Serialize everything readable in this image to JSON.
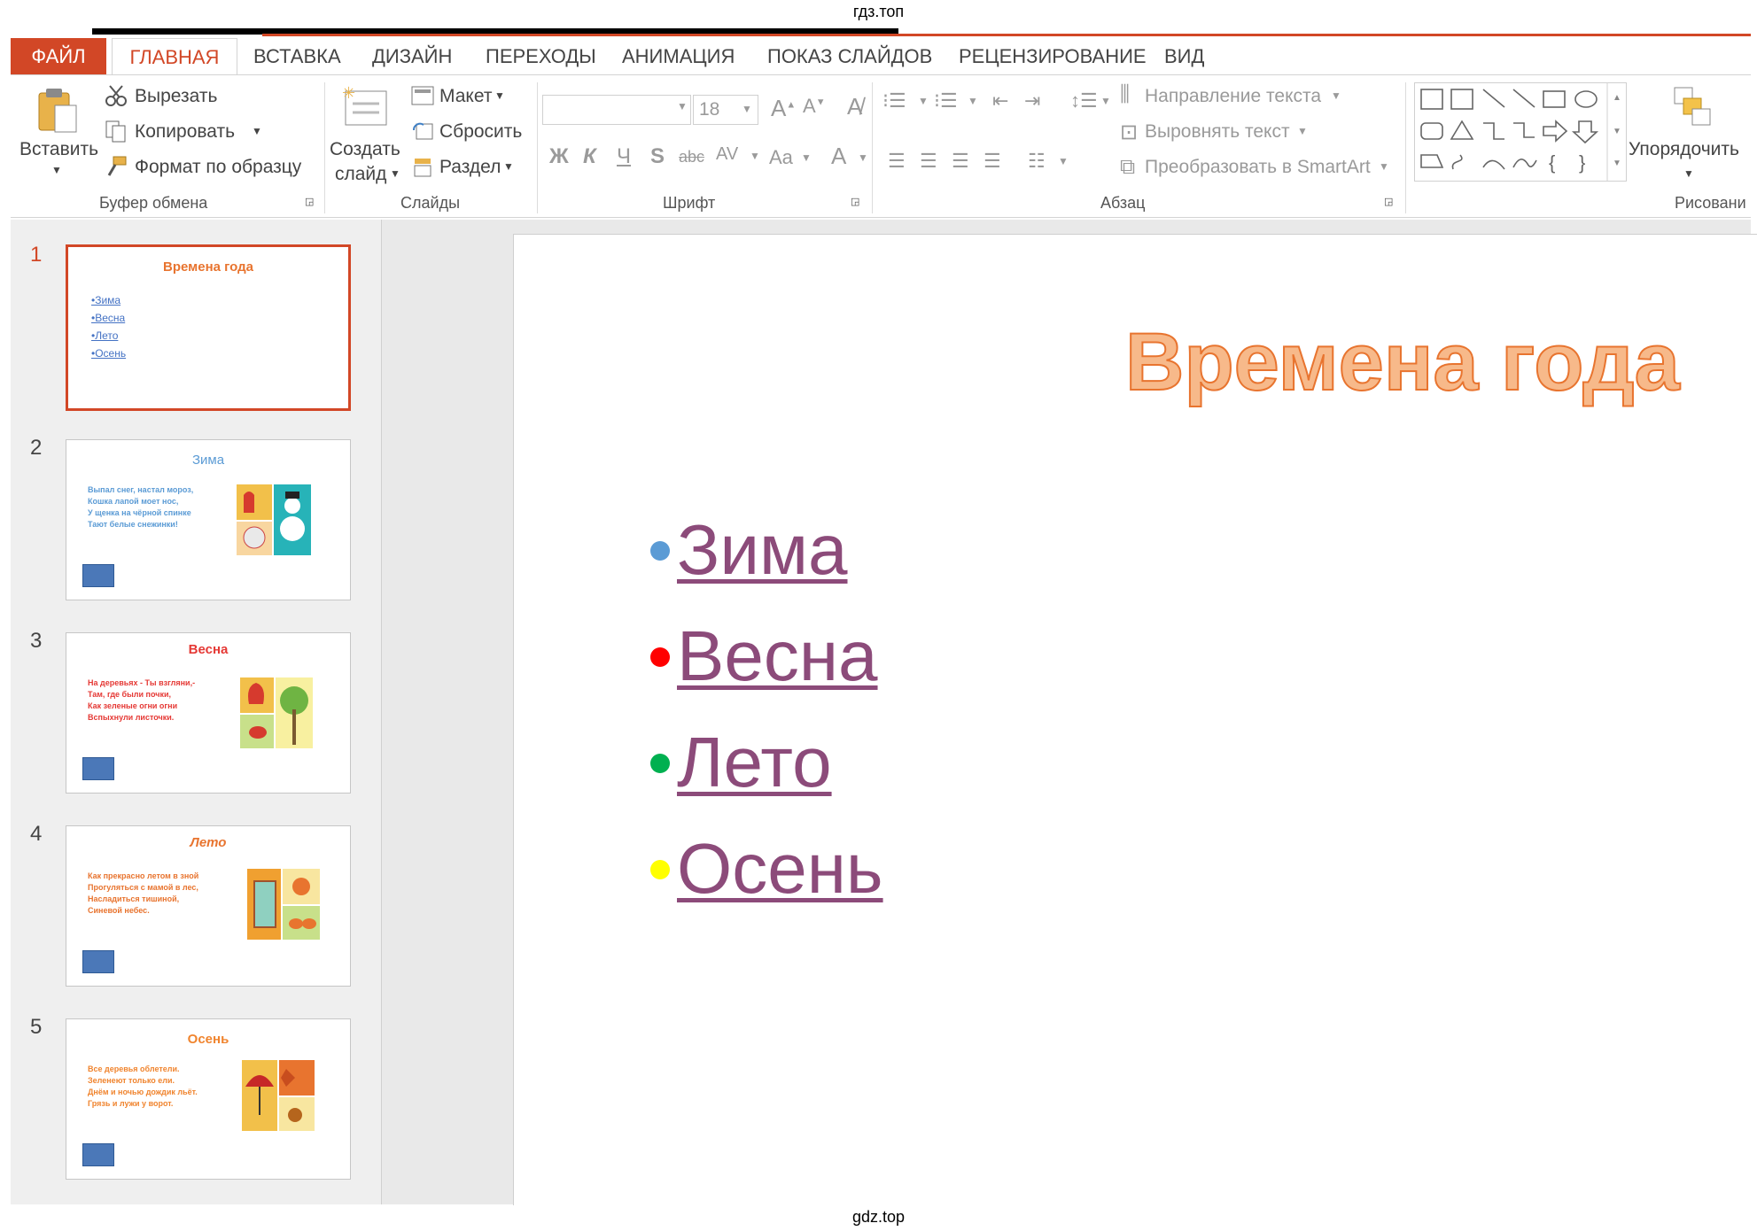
{
  "watermark": {
    "top": "гдз.топ",
    "bottom": "gdz.top"
  },
  "tabs": [
    "ФАЙЛ",
    "ГЛАВНАЯ",
    "ВСТАВКА",
    "ДИЗАЙН",
    "ПЕРЕХОДЫ",
    "АНИМАЦИЯ",
    "ПОКАЗ СЛАЙДОВ",
    "РЕЦЕНЗИРОВАНИЕ",
    "ВИД"
  ],
  "ribbon": {
    "clipboard": {
      "paste": "Вставить",
      "cut": "Вырезать",
      "copy": "Копировать",
      "format_painter": "Формат по образцу",
      "label": "Буфер обмена"
    },
    "slides": {
      "new_slide_1": "Создать",
      "new_slide_2": "слайд",
      "layout": "Макет",
      "reset": "Сбросить",
      "section": "Раздел",
      "label": "Слайды"
    },
    "font": {
      "size": "18",
      "bold": "Ж",
      "italic": "К",
      "underline": "Ч",
      "shadow": "S",
      "strike": "abc",
      "spacing": "AV",
      "case": "Aa",
      "color": "A",
      "label": "Шрифт"
    },
    "paragraph": {
      "direction": "Направление текста",
      "align": "Выровнять текст",
      "smartart": "Преобразовать в SmartArt",
      "label": "Абзац"
    },
    "drawing": {
      "arrange": "Упорядочить",
      "label": "Рисовани"
    }
  },
  "thumbnails": [
    {
      "num": "1",
      "title": "Времена года",
      "color": "#e8742f",
      "lines": [
        "•Зима",
        "•Весна",
        "•Лето",
        "•Осень"
      ]
    },
    {
      "num": "2",
      "title": "Зима",
      "color": "#5b9bd5",
      "lines": [
        "Выпал снег, настал мороз,",
        "Кошка лапой моет нос,",
        "У щенка на чёрной спинке",
        "Тают белые снежинки!"
      ]
    },
    {
      "num": "3",
      "title": "Весна",
      "color": "#e53935",
      "lines": [
        "На деревьях - Ты взгляни,-",
        "Там, где были почки,",
        "Как зеленые огни огни",
        "Вспыхнули листочки."
      ]
    },
    {
      "num": "4",
      "title": "Лето",
      "color": "#e8742f",
      "lines": [
        "Как прекрасно летом в зной",
        "Прогуляться с мамой в лес,",
        "Насладиться тишиной,",
        "Синевой небес."
      ]
    },
    {
      "num": "5",
      "title": "Осень",
      "color": "#f0842e",
      "lines": [
        "Все деревья облетели.",
        "Зеленеют только ели.",
        "Днём и ночью дождик льёт.",
        "Грязь и лужи у ворот."
      ]
    }
  ],
  "slide": {
    "title": "Времена года",
    "bullets": [
      {
        "text": "Зима",
        "dot_color": "#5b9bd5"
      },
      {
        "text": "Весна",
        "dot_color": "#ff0000"
      },
      {
        "text": "Лето",
        "dot_color": "#00b050"
      },
      {
        "text": "Осень",
        "dot_color": "#ffff00"
      }
    ]
  },
  "colors": {
    "accent": "#d24726",
    "link": "#8c4b7a"
  }
}
